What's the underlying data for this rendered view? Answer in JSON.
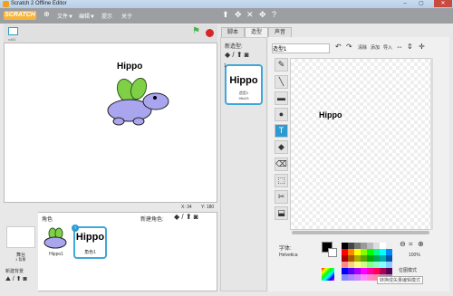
{
  "window": {
    "title": "Scratch 2 Offline Editor",
    "minimize": "–",
    "maximize": "▢",
    "close": "✕"
  },
  "menubar": {
    "logo": "SCRATCH",
    "globe": "⊕",
    "items": [
      "文件▼",
      "编辑▼",
      "提示",
      "关于"
    ],
    "tools": [
      "⬆",
      "✥",
      "✕",
      "✥",
      "?"
    ]
  },
  "stage": {
    "version": "v461",
    "sprite_text": "Hippo",
    "green_flag": "⚑",
    "coords": {
      "x": "X: 34",
      "y": "Y: 180"
    }
  },
  "sprites_panel": {
    "header": "角色",
    "new_sprite_label": "新建角色:",
    "stage_label": "舞台",
    "stage_backdrops": "1 背景",
    "new_backdrop_label": "新建背景",
    "sprites": [
      {
        "name": "Hippo1"
      },
      {
        "name": "角色1",
        "badge": "i"
      }
    ]
  },
  "tabs": [
    "脚本",
    "造型",
    "声音"
  ],
  "costume_panel": {
    "new_label": "新造型:",
    "costume": {
      "name": "造型1",
      "size": "95x23",
      "index": "1",
      "text": "Hippo"
    }
  },
  "editor": {
    "costume_name": "造型1",
    "clear_button": "清除",
    "add_button": "添加",
    "import_button": "导入",
    "canvas_text": "Hippo",
    "font_label": "字体:",
    "font_value": "Helvetica",
    "zoom": "100%",
    "mode_label": "位图模式",
    "convert_button": "转换成矢量编辑模式"
  },
  "colors": {
    "accent": "#2d9bd1",
    "stop": "#d42828",
    "flag": "#4bb34b",
    "menubar": "#9c9ea1"
  }
}
